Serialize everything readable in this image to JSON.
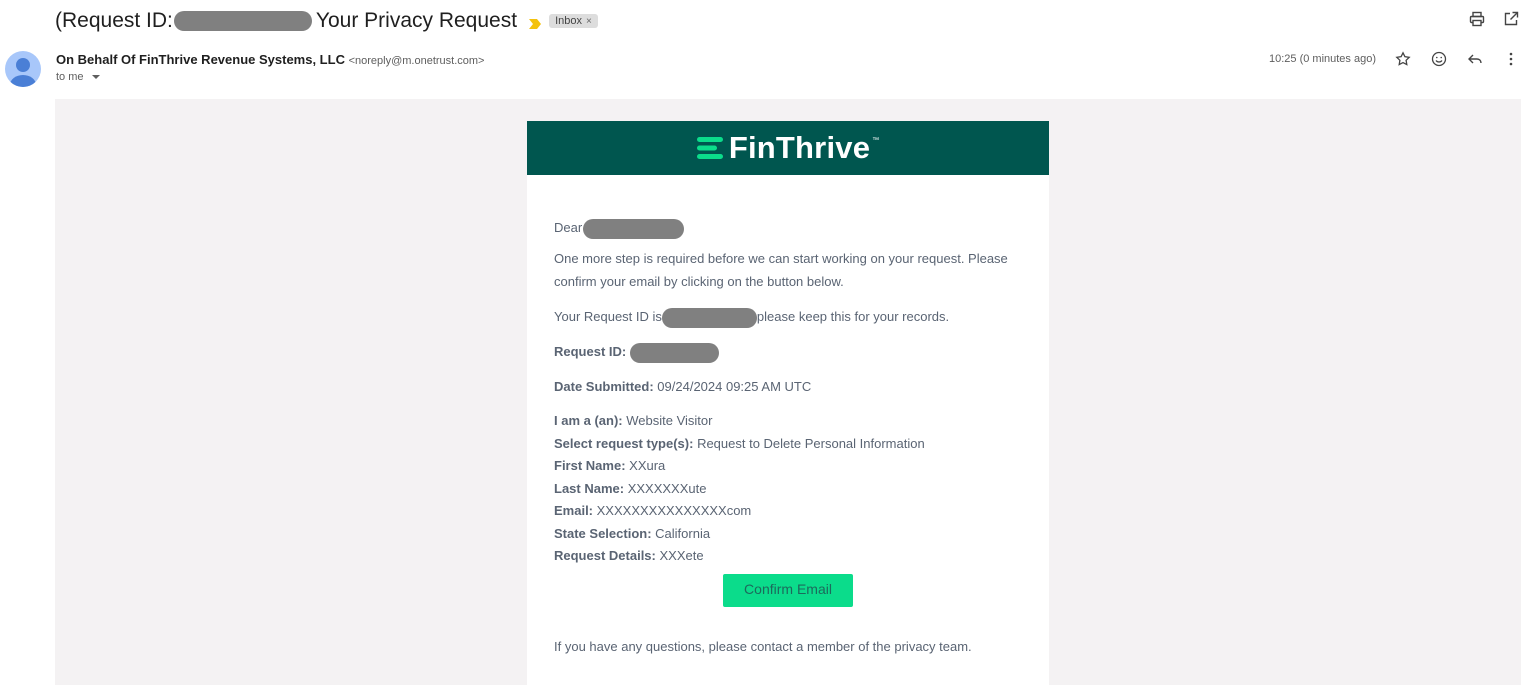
{
  "subject": {
    "prefix": "(Request ID:",
    "suffix": "Your Privacy Request",
    "label_chip": "Inbox",
    "chip_remove": "×"
  },
  "sender": {
    "name": "On Behalf Of FinThrive Revenue Systems, LLC",
    "email": "<noreply@m.onetrust.com>",
    "to": "to me",
    "timestamp": "10:25 (0 minutes ago)"
  },
  "icons": {
    "print": "print-icon",
    "open_new_window": "open-in-new-window-icon",
    "star": "star-icon",
    "emoji": "emoji-reaction-icon",
    "reply": "reply-icon",
    "more": "more-vert-icon",
    "importance": "importance-marker-icon",
    "avatar": "person-avatar-icon"
  },
  "brand": {
    "name": "FinThrive",
    "trademark": "™",
    "banner_color": "#00564f",
    "accent_color": "#0bdc8b"
  },
  "email_body": {
    "dear": "Dear",
    "intro": "One more step is required before we can start working on your request. Please confirm your email by clicking on the button below.",
    "request_id_prefix": "Your Request ID is",
    "request_id_suffix": "please keep this for your records.",
    "request_id_label": "Request ID:",
    "date_label": "Date Submitted:",
    "date_value": "09/24/2024 09:25 AM UTC",
    "details": [
      {
        "label": "I am a (an):",
        "value": "Website Visitor"
      },
      {
        "label": "Select request type(s):",
        "value": "Request to Delete Personal Information"
      },
      {
        "label": "First Name:",
        "value": "XXura"
      },
      {
        "label": "Last Name:",
        "value": "XXXXXXXute"
      },
      {
        "label": "Email:",
        "value": "XXXXXXXXXXXXXXXcom"
      },
      {
        "label": "State Selection:",
        "value": "California"
      },
      {
        "label": "Request Details:",
        "value": "XXXete"
      }
    ],
    "confirm_button": "Confirm Email",
    "footer": "If you have any questions, please contact a member of the privacy team."
  }
}
